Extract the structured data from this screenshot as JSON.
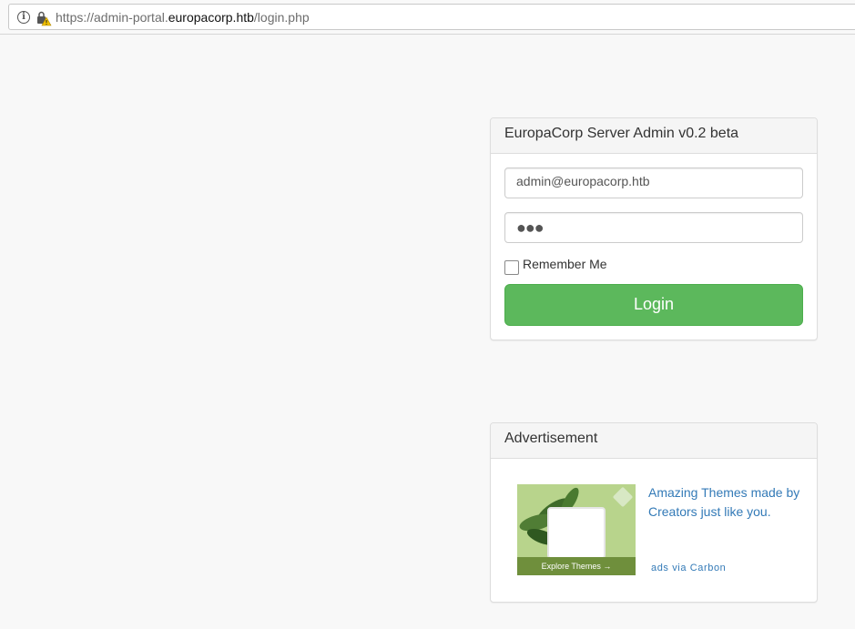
{
  "browser": {
    "url_prefix": "https://admin-portal.",
    "url_host": "europacorp.htb",
    "url_path": "/login.php",
    "info_icon": "info-icon",
    "security_icon": "lock-warning-icon"
  },
  "login_panel": {
    "title": "EuropaCorp Server Admin v0.2 beta",
    "email_value": "admin@europacorp.htb",
    "password_masked": "●●●",
    "remember_label": "Remember Me",
    "remember_checked": false,
    "login_label": "Login"
  },
  "ad_panel": {
    "title": "Advertisement",
    "image_caption": "Explore Themes →",
    "text": "Amazing Themes made by Creators just like you.",
    "via": "ads via Carbon"
  },
  "colors": {
    "login_button": "#5cb85c",
    "link": "#337ab7",
    "page_background": "#f8f8f8"
  }
}
